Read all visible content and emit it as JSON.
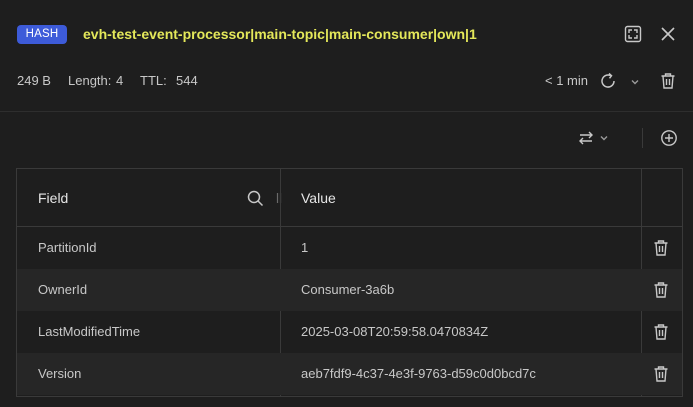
{
  "key": {
    "type_badge": "HASH",
    "name": "evh-test-event-processor|main-topic|main-consumer|own|1"
  },
  "meta": {
    "size": "249 B",
    "length_label": "Length:",
    "length_value": "4",
    "ttl_label": "TTL:",
    "ttl_value": "544",
    "last_refresh": "< 1 min"
  },
  "icons": {
    "fullscreen": "fullscreen-icon",
    "close": "close-icon",
    "refresh": "refresh-icon",
    "auto_refresh_menu": "chevron-down-icon",
    "delete_key": "trash-icon",
    "format_switch": "arrows-swap-icon",
    "add_field": "plus-circle-icon",
    "search": "search-icon",
    "delete_field": "trash-icon"
  },
  "table": {
    "headers": {
      "field": "Field",
      "value": "Value"
    },
    "rows": [
      {
        "field": "PartitionId",
        "value": "1"
      },
      {
        "field": "OwnerId",
        "value": "Consumer-3a6b"
      },
      {
        "field": "LastModifiedTime",
        "value": "2025-03-08T20:59:58.0470834Z"
      },
      {
        "field": "Version",
        "value": "aeb7fdf9-4c37-4e3f-9763-d59c0d0bcd7c"
      }
    ]
  },
  "colors": {
    "background": "#1e1e1e",
    "badge": "#3d5bd9",
    "key_name": "#e4e85a",
    "row_alt": "#262626",
    "border": "#3a3a3a"
  }
}
